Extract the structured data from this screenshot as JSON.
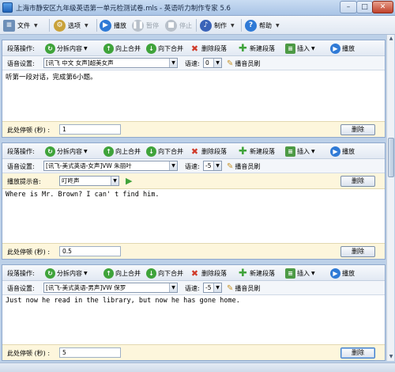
{
  "window": {
    "title": "上海市静安区九年级英语第一单元检测试卷.mls - 英语听力制作专家 5.6",
    "minimize": "–",
    "maximize": "□",
    "close": "✕"
  },
  "main_toolbar": {
    "file": "文件",
    "options": "选项",
    "play": "播放",
    "pause": "暂停",
    "stop": "停止",
    "make": "制作",
    "help": "帮助"
  },
  "segment_labels": {
    "segment_ops": "段落操作:",
    "split": "分拆内容",
    "merge_up": "向上合并",
    "merge_down": "向下合并",
    "delete_segment": "删除段落",
    "new_segment": "新建段落",
    "insert": "插入",
    "play": "播放",
    "voice_setting": "语音设置:",
    "speed": "语速:",
    "announcer": "播音员刷",
    "pause_label": "此处停顿 (秒) :",
    "delete_button": "删除",
    "prompt_label": "播放提示音:"
  },
  "segments": [
    {
      "voice": "[讯飞 中文 女声]超美女声",
      "speed": "0",
      "text": "听第一段对话，完成第6小题。",
      "pause": "1",
      "prompt_sound": null
    },
    {
      "voice": "[讯飞-美式英语-女声]VW 朱丽叶",
      "speed": "-5",
      "text": "Where is Mr. Brown? I can' t find him.",
      "pause": "0.5",
      "prompt_sound": "叮咚声"
    },
    {
      "voice": "[讯飞-美式英语-男声]VW 保罗",
      "speed": "-5",
      "text": "Just now he read in the library, but now he has gone home.",
      "pause": "5",
      "prompt_sound": null
    }
  ],
  "colors": {
    "accent": "#2f7ad6",
    "green": "#3fa33a",
    "red": "#d03b2a",
    "prompt_bg": "#fdf6dc"
  }
}
